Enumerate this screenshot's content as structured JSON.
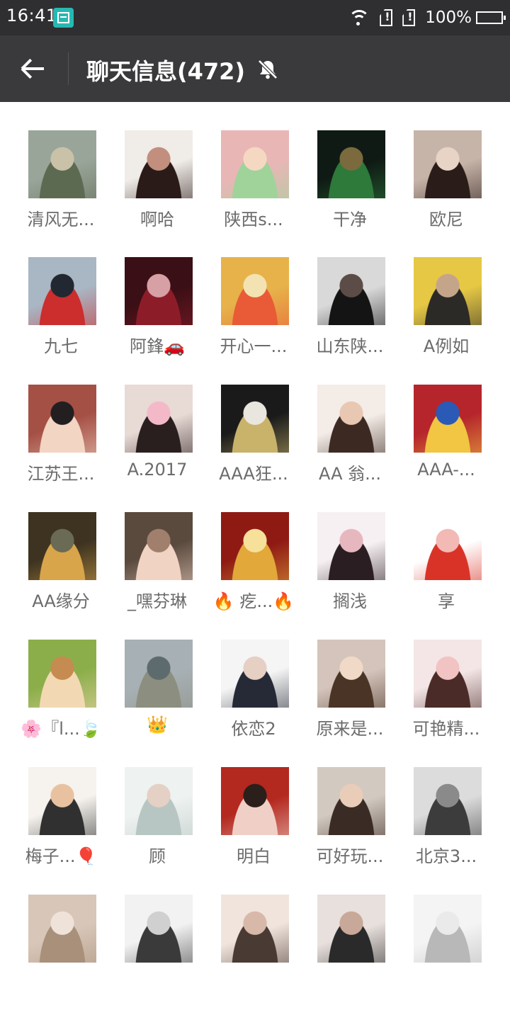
{
  "status_bar": {
    "time": "16:41",
    "battery": "100%"
  },
  "header": {
    "title": "聊天信息(472)"
  },
  "members": [
    {
      "name": "清风无...",
      "colors": [
        "#9aa59a",
        "#5d6a52",
        "#c9c2a8"
      ]
    },
    {
      "name": "啊哈",
      "colors": [
        "#f0ece8",
        "#2a1b18",
        "#c28f7e"
      ]
    },
    {
      "name": "陕西s...",
      "colors": [
        "#e9b6b6",
        "#9fd39a",
        "#f5d8c2"
      ]
    },
    {
      "name": "干净",
      "colors": [
        "#0f1a14",
        "#2d7a3b",
        "#7a6a3d"
      ]
    },
    {
      "name": "欧尼",
      "colors": [
        "#c7b4a8",
        "#2a1c18",
        "#e8d4c6"
      ]
    },
    {
      "name": "九七",
      "colors": [
        "#a9b6c4",
        "#cc2d2d",
        "#222831"
      ]
    },
    {
      "name": "阿鋒🚗",
      "colors": [
        "#3a0f15",
        "#8d1c29",
        "#d6a0a4"
      ]
    },
    {
      "name": "开心一...",
      "colors": [
        "#e7b24a",
        "#e85b36",
        "#f3e3b3"
      ]
    },
    {
      "name": "山东陕...",
      "colors": [
        "#d9d9d9",
        "#141414",
        "#5c4c47"
      ]
    },
    {
      "name": "A例如",
      "colors": [
        "#e6c845",
        "#2c2a26",
        "#c4a58a"
      ]
    },
    {
      "name": "江苏王...",
      "colors": [
        "#a55045",
        "#f3d5c4",
        "#231f20"
      ]
    },
    {
      "name": "A.2017",
      "colors": [
        "#e8dad5",
        "#2a1f1f",
        "#f4b9c9"
      ]
    },
    {
      "name": "AAA狂...",
      "colors": [
        "#1a1a1a",
        "#c9b26a",
        "#e9e6df"
      ]
    },
    {
      "name": "AA 翁...",
      "colors": [
        "#f4ece7",
        "#3c2a22",
        "#e9c8b3"
      ]
    },
    {
      "name": "AAA-...",
      "colors": [
        "#b5252b",
        "#f2c542",
        "#2a59b6"
      ]
    },
    {
      "name": "AA缘分",
      "colors": [
        "#3d3320",
        "#d9a54a",
        "#6a6a55"
      ]
    },
    {
      "name": "_嘿芬琳",
      "colors": [
        "#5a4a3e",
        "#f1d3c4",
        "#a0806d"
      ]
    },
    {
      "name": "🔥 疙...🔥",
      "colors": [
        "#8f1a14",
        "#e2a83a",
        "#f6e09a"
      ]
    },
    {
      "name": "搁浅",
      "colors": [
        "#f6f0f2",
        "#2a1e22",
        "#e7b7c0"
      ]
    },
    {
      "name": "享",
      "colors": [
        "#ffffff",
        "#d93328",
        "#f2b9b5"
      ]
    },
    {
      "name": "🌸『l...🍃",
      "colors": [
        "#8cae4a",
        "#f2d9b3",
        "#c68b50"
      ]
    },
    {
      "name": "👑",
      "colors": [
        "#a7b0b5",
        "#8c8e80",
        "#5e6b6e"
      ]
    },
    {
      "name": "依恋2",
      "colors": [
        "#f5f5f5",
        "#252a36",
        "#e6cfc3"
      ]
    },
    {
      "name": "原来是...",
      "colors": [
        "#d4c4bb",
        "#4a3426",
        "#f1d9c8"
      ]
    },
    {
      "name": "可艳精...",
      "colors": [
        "#f4e6e6",
        "#4a2b28",
        "#f1c3c3"
      ]
    },
    {
      "name": "梅子...🎈",
      "colors": [
        "#f6f3ee",
        "#303030",
        "#e8c2a0"
      ]
    },
    {
      "name": "顾",
      "colors": [
        "#eef2f0",
        "#b7c6c2",
        "#e4d0c5"
      ]
    },
    {
      "name": "明白",
      "colors": [
        "#b3281f",
        "#f0d0c6",
        "#2a1f1a"
      ]
    },
    {
      "name": "可好玩...",
      "colors": [
        "#d2c9c0",
        "#3a2c24",
        "#e9cdb8"
      ]
    },
    {
      "name": "北京3...",
      "colors": [
        "#dcdcdc",
        "#3c3c3c",
        "#8a8a8a"
      ]
    },
    {
      "name": "",
      "colors": [
        "#d8c6b8",
        "#a8907a",
        "#efe2d8"
      ]
    },
    {
      "name": "",
      "colors": [
        "#f2f2f2",
        "#3a3a3a",
        "#d0d0d0"
      ]
    },
    {
      "name": "",
      "colors": [
        "#f0e4dc",
        "#4a3a34",
        "#d8b8a8"
      ]
    },
    {
      "name": "",
      "colors": [
        "#e8e0dc",
        "#2a2a2a",
        "#c8a898"
      ]
    },
    {
      "name": "",
      "colors": [
        "#f4f4f4",
        "#b8b8b8",
        "#eaeaea"
      ]
    }
  ]
}
